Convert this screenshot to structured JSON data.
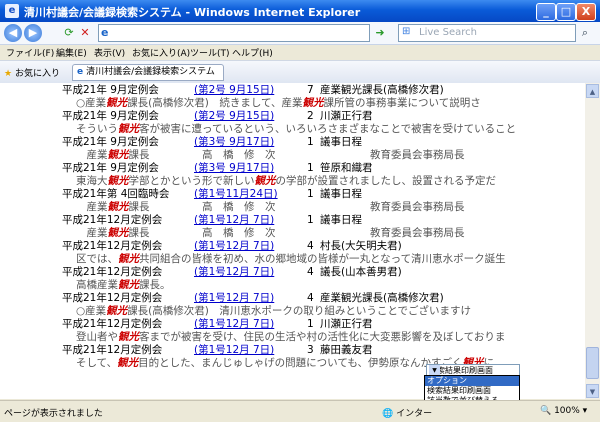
{
  "window": {
    "title": "清川村議会/会議録検索システム - Windows Internet Explorer",
    "minimize": "_",
    "maximize": "□",
    "close": "X"
  },
  "address_bar": {
    "back": "◀",
    "forward": "▶",
    "go": "➜",
    "search_placeholder": "Live Search"
  },
  "menu": [
    "ファイル(F)",
    "編集(E)",
    "表示(V)",
    "お気に入り(A)",
    "ツール(T)",
    "ヘルプ(H)"
  ],
  "favorites": {
    "label": "お気に入り",
    "tab_title": "清川村議会/会議録検索システム"
  },
  "results": [
    {
      "session": "平成21年 9月定例会",
      "issue": "(第2号 9月15日)",
      "num": "7",
      "speaker": "産業観光課長(高橋修次君)",
      "snippet": [
        {
          "t": "○産業"
        },
        {
          "k": "観光"
        },
        {
          "t": "課長(高橋修次君)　続きまして、産業"
        },
        {
          "k": "観光"
        },
        {
          "t": "課所管の事務事業について説明さ"
        }
      ]
    },
    {
      "session": "平成21年 9月定例会",
      "issue": "(第2号 9月15日)",
      "num": "2",
      "speaker": "川瀬正行君",
      "snippet": [
        {
          "t": "そういう"
        },
        {
          "k": "観光"
        },
        {
          "t": "客が被害に遭っているという、いろいろさまざまなことで被害を受けていること"
        }
      ]
    },
    {
      "session": "平成21年 9月定例会",
      "issue": "(第3号 9月17日)",
      "num": "1",
      "speaker": "議事日程",
      "snippet": [
        {
          "t": "　産業"
        },
        {
          "k": "観光"
        },
        {
          "t": "課長　　　　　高　橋　修　次　　　　　　　　　教育委員会事務局長"
        }
      ]
    },
    {
      "session": "平成21年 9月定例会",
      "issue": "(第3号 9月17日)",
      "num": "1",
      "speaker": "笹原和織君",
      "snippet": [
        {
          "t": "東海大"
        },
        {
          "k": "観光"
        },
        {
          "t": "学部とかという形で新しい"
        },
        {
          "k": "観光"
        },
        {
          "t": "の学部が設置されましたし、設置される予定だ"
        }
      ]
    },
    {
      "session": "平成21年第 4回臨時会",
      "issue": "(第1号11月24日)",
      "num": "1",
      "speaker": "議事日程",
      "snippet": [
        {
          "t": "　産業"
        },
        {
          "k": "観光"
        },
        {
          "t": "課長　　　　　高　橋　修　次　　　　　　　　　教育委員会事務局長"
        }
      ]
    },
    {
      "session": "平成21年12月定例会",
      "issue": "(第1号12月 7日)",
      "num": "1",
      "speaker": "議事日程",
      "snippet": [
        {
          "t": "　産業"
        },
        {
          "k": "観光"
        },
        {
          "t": "課長　　　　　高　橋　修　次　　　　　　　　　教育委員会事務局長"
        }
      ]
    },
    {
      "session": "平成21年12月定例会",
      "issue": "(第1号12月 7日)",
      "num": "4",
      "speaker": "村長(大矢明夫君)",
      "snippet": [
        {
          "t": "区では、"
        },
        {
          "k": "観光"
        },
        {
          "t": "共同組合の皆様を初め、水の郷地域の皆様が一丸となって清川恵水ポーク誕生"
        }
      ]
    },
    {
      "session": "平成21年12月定例会",
      "issue": "(第1号12月 7日)",
      "num": "4",
      "speaker": "議長(山本善男君)",
      "snippet": [
        {
          "t": "高橋産業"
        },
        {
          "k": "観光"
        },
        {
          "t": "課長。"
        }
      ]
    },
    {
      "session": "平成21年12月定例会",
      "issue": "(第1号12月 7日)",
      "num": "4",
      "speaker": "産業観光課長(高橋修次君)",
      "snippet": [
        {
          "t": "○産業"
        },
        {
          "k": "観光"
        },
        {
          "t": "課長(高橋修次君)　清川恵水ポークの取り組みということでございますけ"
        }
      ]
    },
    {
      "session": "平成21年12月定例会",
      "issue": "(第1号12月 7日)",
      "num": "1",
      "speaker": "川瀬正行君",
      "snippet": [
        {
          "t": "登山者や"
        },
        {
          "k": "観光"
        },
        {
          "t": "客までが被害を受け、住民の生活や村の活性化に大変悪影響を及ぼしておりま"
        }
      ]
    },
    {
      "session": "平成21年12月定例会",
      "issue": "(第1号12月 7日)",
      "num": "3",
      "speaker": "藤田義友君",
      "snippet": [
        {
          "t": "そして、"
        },
        {
          "k": "観光"
        },
        {
          "t": "目的とした、まんじゅしゃげの問題についても、伊勢原なんかすごく"
        },
        {
          "k": "観光"
        },
        {
          "t": "に"
        }
      ]
    }
  ],
  "print_select": {
    "value": "検索結果印刷画面",
    "options": [
      "オプション",
      "検索結果印刷画面",
      "該当数で並び替える",
      "日付順で並び替える"
    ],
    "selected_index": 0
  },
  "status_bar": {
    "text": "ページが表示されました",
    "zone": "インター",
    "zoom": "100%"
  }
}
